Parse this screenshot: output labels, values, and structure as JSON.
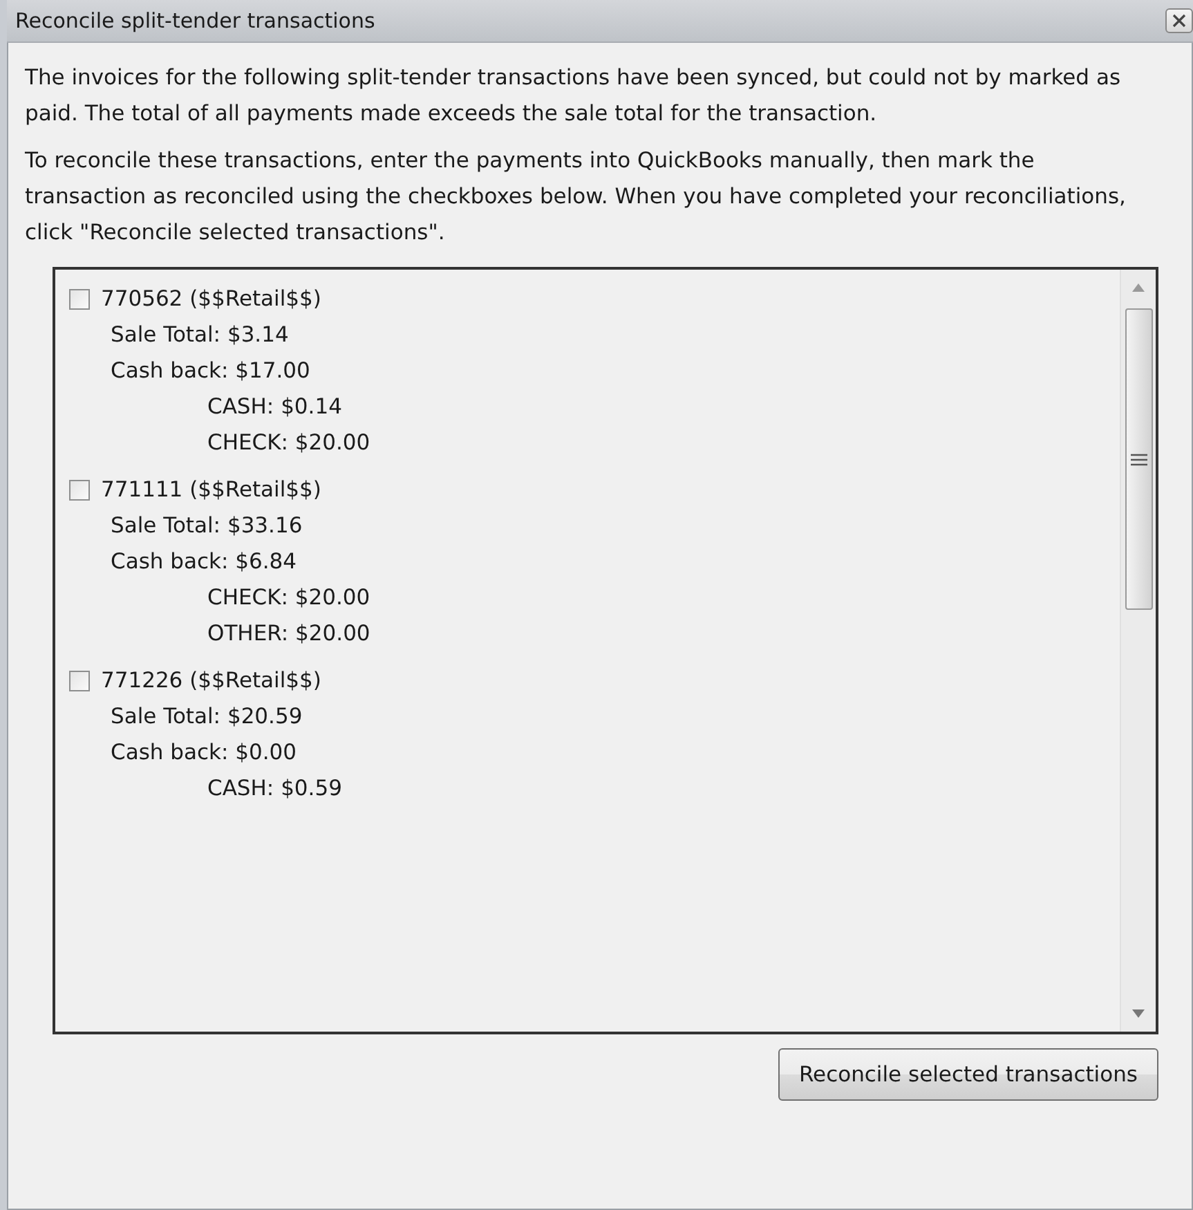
{
  "window": {
    "title": "Reconcile split-tender transactions"
  },
  "paragraphs": [
    "The invoices for the following split-tender transactions have been synced, but could not by marked as paid. The total of all payments made exceeds the sale total for the transaction.",
    "To reconcile these transactions, enter the payments into QuickBooks manually, then mark the transaction as reconciled using the checkboxes below. When you have completed your reconciliations, click \"Reconcile selected transactions\"."
  ],
  "transactions": [
    {
      "checked": false,
      "title": "770562 ($$Retail$$)",
      "sale_total": "Sale Total: $3.14",
      "cash_back": "Cash back: $17.00",
      "payments": [
        "CASH: $0.14",
        "CHECK: $20.00"
      ]
    },
    {
      "checked": false,
      "title": "771111 ($$Retail$$)",
      "sale_total": "Sale Total: $33.16",
      "cash_back": "Cash back: $6.84",
      "payments": [
        "CHECK: $20.00",
        "OTHER: $20.00"
      ]
    },
    {
      "checked": false,
      "title": "771226 ($$Retail$$)",
      "sale_total": "Sale Total: $20.59",
      "cash_back": "Cash back: $0.00",
      "payments": [
        "CASH: $0.59"
      ]
    }
  ],
  "button": "Reconcile selected transactions"
}
